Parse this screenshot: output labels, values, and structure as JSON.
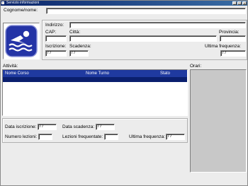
{
  "window": {
    "title": "Servizio informazioni"
  },
  "form": {
    "cognome_label": "Cognome/nome:",
    "cognome_value": "",
    "indirizzo_label": "Indirizzo:",
    "indirizzo_value": "",
    "cap_label": "CAP:",
    "cap_value": "",
    "citta_label": "Città:",
    "citta_value": "",
    "provincia_label": "Provincia:",
    "provincia_value": "",
    "iscrizione_label": "Iscrizione:",
    "iscrizione_value": "/ /",
    "scadenza_label": "Scadenza:",
    "scadenza_value": "/ /",
    "ultima_freq_label": "Ultima frequenza:",
    "ultima_freq_value": "/ /"
  },
  "attivita": {
    "label": "Attività:",
    "columns": [
      "Nome Corso",
      "Nome Turno",
      "Stato"
    ]
  },
  "orari": {
    "label": "Orari:"
  },
  "stats": {
    "data_iscrizione_label": "Data iscrizione:",
    "data_iscrizione_value": "/ /",
    "data_scadenza_label": "Data scadenza:",
    "data_scadenza_value": "/ /",
    "numero_lezioni_label": "Numero lezioni:",
    "numero_lezioni_value": "",
    "lezioni_frequentate_label": "Lezioni frequentate:",
    "lezioni_frequentate_value": "",
    "ultima_frequenza_label": "Ultima frequenza:",
    "ultima_frequenza_value": "/ /"
  },
  "icons": {
    "photo": "swimmer-icon",
    "accent": "#1f3aa0"
  }
}
